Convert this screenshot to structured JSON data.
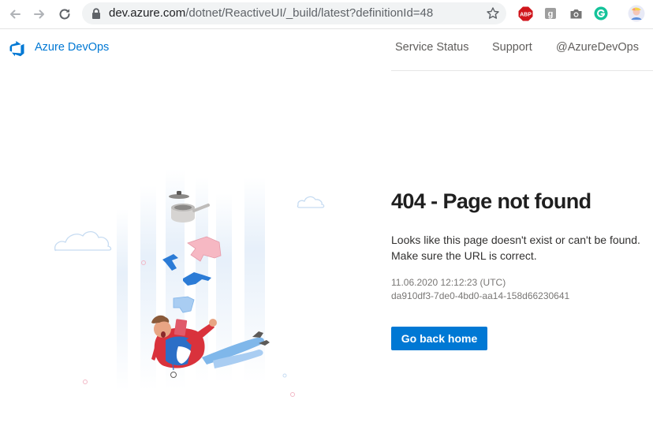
{
  "browser": {
    "url_host": "dev.azure.com",
    "url_path": "/dotnet/ReactiveUI/_build/latest?definitionId=48",
    "extensions": [
      {
        "name": "adblock-plus",
        "label": "ABP"
      },
      {
        "name": "g-extension",
        "label": "g"
      },
      {
        "name": "camera",
        "label": ""
      },
      {
        "name": "grammarly",
        "label": ""
      },
      {
        "name": "profile-avatar",
        "label": ""
      }
    ]
  },
  "header": {
    "brand": "Azure DevOps",
    "links": [
      "Service Status",
      "Support",
      "@AzureDevOps"
    ]
  },
  "error": {
    "title": "404 - Page not found",
    "line1": "Looks like this page doesn't exist or can't be found.",
    "line2": "Make sure the URL is correct.",
    "timestamp": "11.06.2020 12:12:23 (UTC)",
    "activity_id": "da910df3-7de0-4bd0-aa14-158d66230641",
    "button": "Go back home"
  },
  "colors": {
    "accent": "#0078d4",
    "title": "#1f1f1f",
    "muted": "#797775"
  }
}
